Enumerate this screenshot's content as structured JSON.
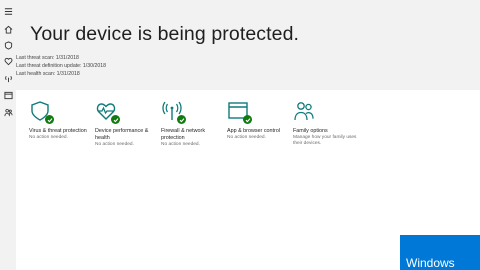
{
  "hero": {
    "title": "Your device is being protected.",
    "scans": [
      "Last threat scan: 1/31/2018",
      "Last threat definition update: 1/30/2018",
      "Last health scan: 1/31/2018"
    ]
  },
  "nav": {
    "items": [
      "menu-icon",
      "home-icon",
      "shield-icon",
      "heart-icon",
      "wifi-icon",
      "browser-icon",
      "family-icon"
    ]
  },
  "tiles": [
    {
      "title": "Virus & threat protection",
      "status": "No action needed.",
      "icon": "shield-icon"
    },
    {
      "title": "Device performance & health",
      "status": "No action needed.",
      "icon": "heart-pulse-icon"
    },
    {
      "title": "Firewall & network protection",
      "status": "No action needed.",
      "icon": "antenna-icon"
    },
    {
      "title": "App & browser control",
      "status": "No action needed.",
      "icon": "browser-window-icon"
    },
    {
      "title": "Family options",
      "status": "Manage how your family uses their devices.",
      "icon": "people-icon"
    }
  ],
  "watermark": {
    "text": "Windows"
  },
  "colors": {
    "accent": "#107c10",
    "badge": "#0078d7",
    "icon": "#0f7a7a",
    "hero_bg": "#f2f2f2"
  }
}
